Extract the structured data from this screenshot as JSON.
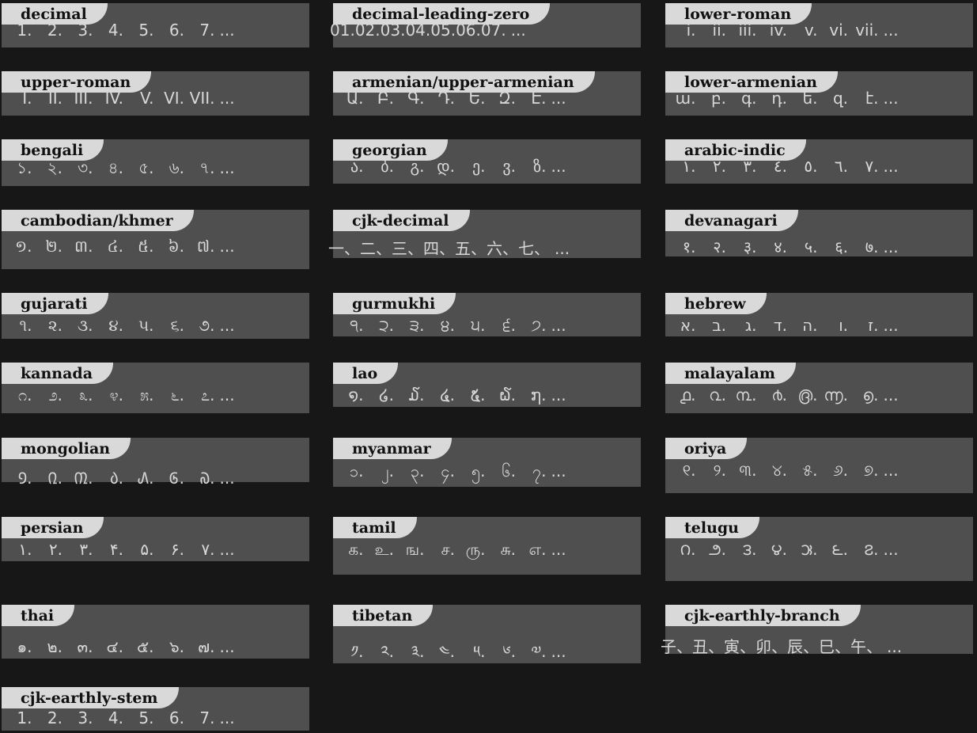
{
  "styles": [
    {
      "name": "decimal",
      "markers": [
        "1.",
        "2.",
        "3.",
        "4.",
        "5.",
        "6.",
        "7."
      ],
      "ellipsis": "..."
    },
    {
      "name": "decimal-leading-zero",
      "markers": [
        "01.",
        "02.",
        "03.",
        "04.",
        "05.",
        "06.",
        "07."
      ],
      "ellipsis": "..."
    },
    {
      "name": "lower-roman",
      "markers": [
        "i.",
        "ii.",
        "iii.",
        "iv.",
        "v.",
        "vi.",
        "vii."
      ],
      "ellipsis": "..."
    },
    {
      "name": "upper-roman",
      "markers": [
        "I.",
        "II.",
        "III.",
        "IV.",
        "V.",
        "VI.",
        "VII."
      ],
      "ellipsis": "..."
    },
    {
      "name": "armenian/upper-armenian",
      "markers": [
        "Ա.",
        "Բ.",
        "Գ.",
        "Դ.",
        "Ե.",
        "Զ.",
        "Է."
      ],
      "ellipsis": "..."
    },
    {
      "name": "lower-armenian",
      "markers": [
        "ա.",
        "բ.",
        "գ.",
        "դ.",
        "ե.",
        "զ.",
        "է."
      ],
      "ellipsis": "..."
    },
    {
      "name": "bengali",
      "markers": [
        "১.",
        "২.",
        "৩.",
        "৪.",
        "৫.",
        "৬.",
        "৭."
      ],
      "ellipsis": "..."
    },
    {
      "name": "georgian",
      "markers": [
        "ა.",
        "ბ.",
        "გ.",
        "დ.",
        "ე.",
        "ვ.",
        "ზ."
      ],
      "ellipsis": "..."
    },
    {
      "name": "arabic-indic",
      "markers": [
        "١.",
        "٢.",
        "٣.",
        "٤.",
        "٥.",
        "٦.",
        "٧."
      ],
      "ellipsis": "..."
    },
    {
      "name": "cambodian/khmer",
      "markers": [
        "១.",
        "២.",
        "៣.",
        "៤.",
        "៥.",
        "៦.",
        "៧."
      ],
      "ellipsis": "..."
    },
    {
      "name": "cjk-decimal",
      "markers": [
        "一、",
        "二、",
        "三、",
        "四、",
        "五、",
        "六、",
        "七、"
      ],
      "ellipsis": "..."
    },
    {
      "name": "devanagari",
      "markers": [
        "१.",
        "२.",
        "३.",
        "४.",
        "५.",
        "६.",
        "७."
      ],
      "ellipsis": "..."
    },
    {
      "name": "gujarati",
      "markers": [
        "૧.",
        "૨.",
        "૩.",
        "૪.",
        "૫.",
        "૬.",
        "૭."
      ],
      "ellipsis": "..."
    },
    {
      "name": "gurmukhi",
      "markers": [
        "੧.",
        "੨.",
        "੩.",
        "੪.",
        "੫.",
        "੬.",
        "੭."
      ],
      "ellipsis": "..."
    },
    {
      "name": "hebrew",
      "markers": [
        "א.",
        "ב.",
        "ג.",
        "ד.",
        "ה.",
        "ו.",
        "ז."
      ],
      "ellipsis": "..."
    },
    {
      "name": "kannada",
      "markers": [
        "೧.",
        "೨.",
        "೩.",
        "೪.",
        "೫.",
        "೬.",
        "೭."
      ],
      "ellipsis": "..."
    },
    {
      "name": "lao",
      "markers": [
        "໑.",
        "໒.",
        "໓.",
        "໔.",
        "໕.",
        "໖.",
        "໗."
      ],
      "ellipsis": "..."
    },
    {
      "name": "malayalam",
      "markers": [
        "൧.",
        "൨.",
        "൩.",
        "൪.",
        "൫.",
        "൬.",
        "൭."
      ],
      "ellipsis": "..."
    },
    {
      "name": "mongolian",
      "markers": [
        "᠑.",
        "᠒.",
        "᠓.",
        "᠔.",
        "᠕.",
        "᠖.",
        "᠗."
      ],
      "ellipsis": "..."
    },
    {
      "name": "myanmar",
      "markers": [
        "၁.",
        "၂.",
        "၃.",
        "၄.",
        "၅.",
        "၆.",
        "၇."
      ],
      "ellipsis": "..."
    },
    {
      "name": "oriya",
      "markers": [
        "୧.",
        "୨.",
        "୩.",
        "୪.",
        "୫.",
        "୬.",
        "୭."
      ],
      "ellipsis": "..."
    },
    {
      "name": "persian",
      "markers": [
        "۱.",
        "۲.",
        "۳.",
        "۴.",
        "۵.",
        "۶.",
        "۷."
      ],
      "ellipsis": "..."
    },
    {
      "name": "tamil",
      "markers": [
        "க.",
        "உ.",
        "ங.",
        "ச.",
        "ரு.",
        "சு.",
        "எ."
      ],
      "ellipsis": "..."
    },
    {
      "name": "telugu",
      "markers": [
        "౧.",
        "౨.",
        "౩.",
        "౪.",
        "౫.",
        "౬.",
        "౭."
      ],
      "ellipsis": "..."
    },
    {
      "name": "thai",
      "markers": [
        "๑.",
        "๒.",
        "๓.",
        "๔.",
        "๕.",
        "๖.",
        "๗."
      ],
      "ellipsis": "..."
    },
    {
      "name": "tibetan",
      "markers": [
        "༡.",
        "༢.",
        "༣.",
        "༤.",
        "༥.",
        "༦.",
        "༧."
      ],
      "ellipsis": "..."
    },
    {
      "name": "cjk-earthly-branch",
      "markers": [
        "子、",
        "丑、",
        "寅、",
        "卯、",
        "辰、",
        "巳、",
        "午、"
      ],
      "ellipsis": "..."
    },
    {
      "name": "cjk-earthly-stem",
      "markers": [
        "1.",
        "2.",
        "3.",
        "4.",
        "5.",
        "6.",
        "7."
      ],
      "ellipsis": "..."
    }
  ]
}
